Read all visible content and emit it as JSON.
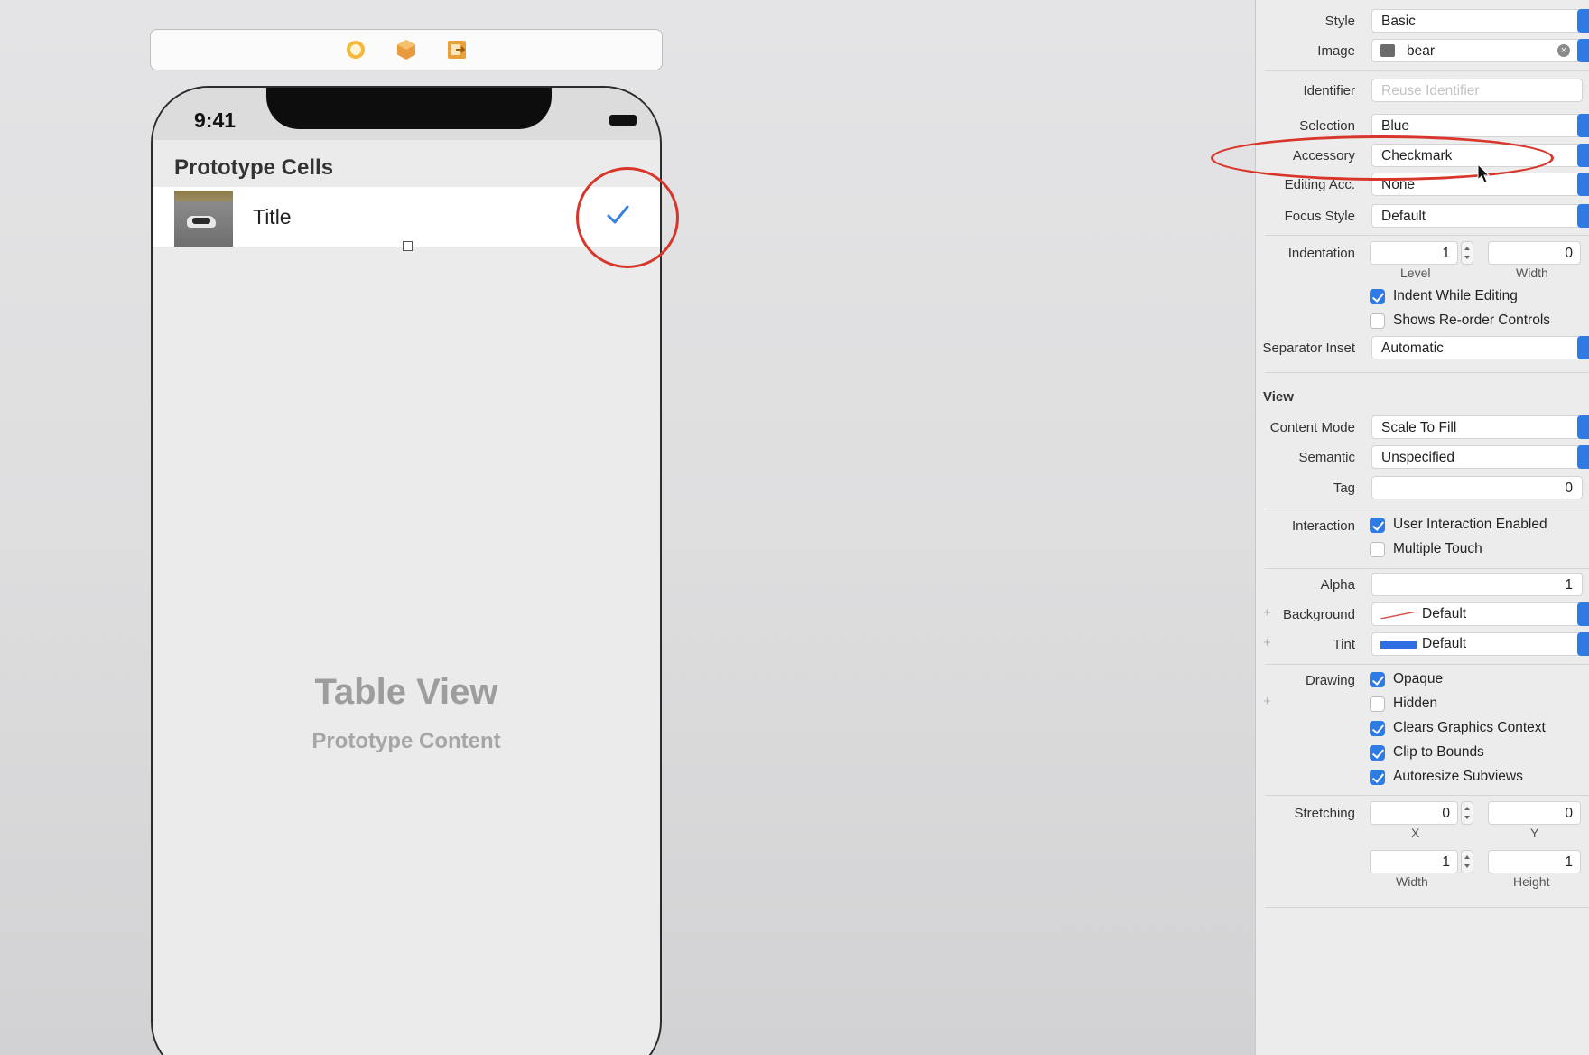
{
  "canvas": {
    "status_time": "9:41",
    "section_header": "Prototype Cells",
    "cell_title": "Title",
    "placeholder_title": "Table View",
    "placeholder_subtitle": "Prototype Content"
  },
  "inspector": {
    "table_cell": {
      "style": {
        "label": "Style",
        "value": "Basic"
      },
      "image": {
        "label": "Image",
        "value": "bear"
      },
      "identifier": {
        "label": "Identifier",
        "placeholder": "Reuse Identifier"
      },
      "selection": {
        "label": "Selection",
        "value": "Blue"
      },
      "accessory": {
        "label": "Accessory",
        "value": "Checkmark"
      },
      "editing_acc": {
        "label": "Editing Acc.",
        "value": "None"
      },
      "focus_style": {
        "label": "Focus Style",
        "value": "Default"
      },
      "indentation": {
        "label": "Indentation",
        "level": "1",
        "width": "0",
        "level_label": "Level",
        "width_label": "Width"
      },
      "indent_while_editing": {
        "label": "Indent While Editing",
        "checked": true
      },
      "shows_reorder": {
        "label": "Shows Re-order Controls",
        "checked": false
      },
      "separator_inset": {
        "label": "Separator Inset",
        "value": "Automatic"
      }
    },
    "view": {
      "section_title": "View",
      "content_mode": {
        "label": "Content Mode",
        "value": "Scale To Fill"
      },
      "semantic": {
        "label": "Semantic",
        "value": "Unspecified"
      },
      "tag": {
        "label": "Tag",
        "value": "0"
      },
      "interaction": {
        "label": "Interaction"
      },
      "user_interaction": {
        "label": "User Interaction Enabled",
        "checked": true
      },
      "multiple_touch": {
        "label": "Multiple Touch",
        "checked": false
      },
      "alpha": {
        "label": "Alpha",
        "value": "1"
      },
      "background": {
        "label": "Background",
        "value": "Default",
        "swatch_color": "#d9534f"
      },
      "tint": {
        "label": "Tint",
        "value": "Default",
        "swatch_color": "#2f6fe4"
      },
      "drawing": {
        "label": "Drawing"
      },
      "opaque": {
        "label": "Opaque",
        "checked": true
      },
      "hidden": {
        "label": "Hidden",
        "checked": false
      },
      "clears_graphics": {
        "label": "Clears Graphics Context",
        "checked": true
      },
      "clip_to_bounds": {
        "label": "Clip to Bounds",
        "checked": true
      },
      "autoresize": {
        "label": "Autoresize Subviews",
        "checked": true
      },
      "stretching": {
        "label": "Stretching",
        "x": "0",
        "y": "0",
        "width": "1",
        "height": "1",
        "x_label": "X",
        "y_label": "Y",
        "width_label": "Width",
        "height_label": "Height"
      }
    }
  },
  "colors": {
    "accent": "#2f7be4",
    "annotation": "#d8362a",
    "checkmark": "#3b82e0"
  }
}
